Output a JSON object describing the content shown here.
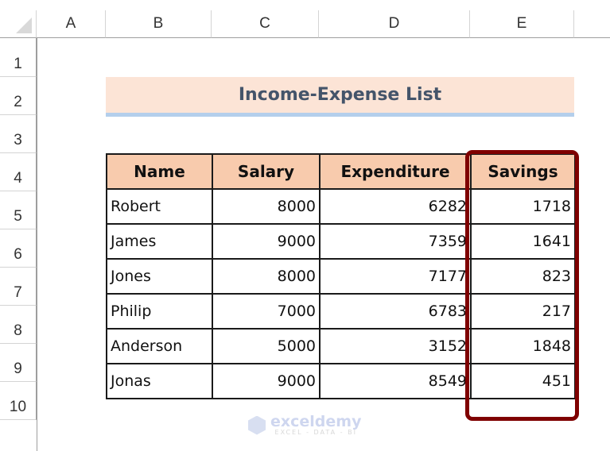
{
  "spreadsheet": {
    "columns": [
      "A",
      "B",
      "C",
      "D",
      "E"
    ],
    "rows": [
      "1",
      "2",
      "3",
      "4",
      "5",
      "6",
      "7",
      "8",
      "9",
      "10"
    ]
  },
  "title": "Income-Expense List",
  "table": {
    "headers": [
      "Name",
      "Salary",
      "Expenditure",
      "Savings"
    ],
    "rows": [
      [
        "Robert",
        "8000",
        "6282",
        "1718"
      ],
      [
        "James",
        "9000",
        "7359",
        "1641"
      ],
      [
        "Jones",
        "8000",
        "7177",
        "823"
      ],
      [
        "Philip",
        "7000",
        "6783",
        "217"
      ],
      [
        "Anderson",
        "5000",
        "3152",
        "1848"
      ],
      [
        "Jonas",
        "9000",
        "8549",
        "451"
      ]
    ]
  },
  "highlight": {
    "column": "Savings",
    "color": "#7f0000"
  },
  "watermark": {
    "brand": "exceldemy",
    "tagline": "EXCEL - DATA - BI"
  }
}
